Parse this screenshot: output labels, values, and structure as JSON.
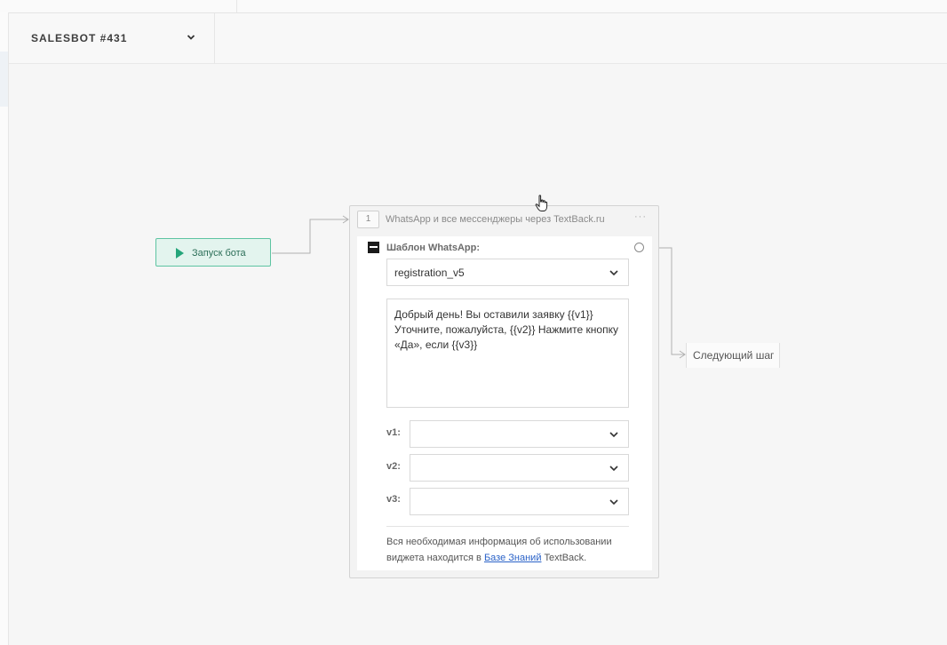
{
  "header": {
    "bot_name": "SALESBOT #431"
  },
  "start": {
    "label": "Запуск бота"
  },
  "step": {
    "number": "1",
    "title": "WhatsApp и все мессенджеры через TextBack.ru",
    "menu": "···",
    "template_label": "Шаблон WhatsApp:",
    "template_value": "registration_v5",
    "template_text": "Добрый день! Вы оставили заявку {{v1}} Уточните, пожалуйста, {{v2}} Нажмите кнопку «Да», если {{v3}}",
    "vars": [
      {
        "label": "v1:",
        "value": ""
      },
      {
        "label": "v2:",
        "value": ""
      },
      {
        "label": "v3:",
        "value": ""
      }
    ],
    "note_before": "Вся необходимая информация об использовании виджета находится в ",
    "note_link": "Базе Знаний",
    "note_after": " TextBack."
  },
  "next_step": {
    "label": "Следующий шаг"
  }
}
